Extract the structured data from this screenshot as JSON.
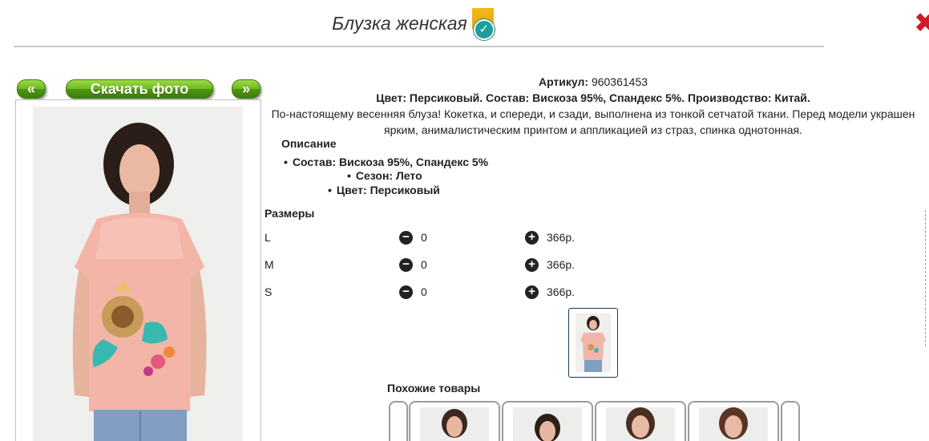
{
  "header": {
    "title": "Блузка женская",
    "badge_icon": "check-badge-icon",
    "close_icon": "close-icon"
  },
  "photo_nav": {
    "prev_label": "«",
    "download_label": "Скачать фото",
    "next_label": "»"
  },
  "product": {
    "article_label": "Артикул:",
    "article_value": "960361453",
    "attributes_line": "Цвет: Персиковый. Состав: Вискоза 95%, Спандекс 5%. Производство: Китай.",
    "description_line1": "По-настоящему весенняя блуза! Кокетка, и спереди, и сзади, выполнена из тонкой сетчатой ткани. Перед модели украшен",
    "description_line2": "ярким, анималистическим принтом и аппликацией из страз, спинка однотонная.",
    "description_heading": "Описание",
    "details": [
      "Состав: Вискоза 95%, Спандекс 5%",
      "Сезон: Лето",
      "Цвет: Персиковый"
    ]
  },
  "sizes": {
    "heading": "Размеры",
    "rows": [
      {
        "name": "L",
        "qty": "0",
        "price": "366р."
      },
      {
        "name": "M",
        "qty": "0",
        "price": "366р."
      },
      {
        "name": "S",
        "qty": "0",
        "price": "366р."
      }
    ]
  },
  "similar": {
    "heading": "Похожие товары"
  },
  "colors": {
    "accent_green": "#6cb81f",
    "close_red": "#d0192b",
    "badge_teal": "#1f9d9b",
    "badge_yellow": "#f4b81b",
    "blouse_peach": "#f3b5a8"
  }
}
